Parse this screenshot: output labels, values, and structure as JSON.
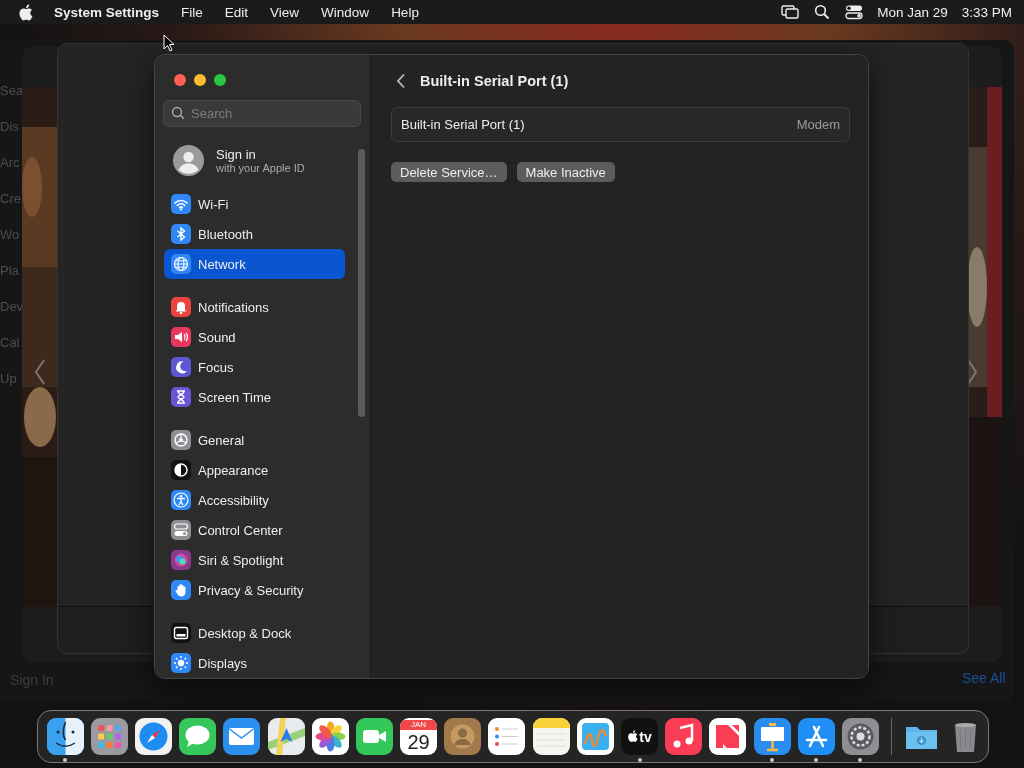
{
  "menu_bar": {
    "items": [
      {
        "label": "System Settings",
        "kind": "app"
      },
      {
        "label": "File",
        "kind": "menu"
      },
      {
        "label": "Edit",
        "kind": "menu"
      },
      {
        "label": "View",
        "kind": "menu"
      },
      {
        "label": "Window",
        "kind": "menu"
      },
      {
        "label": "Help",
        "kind": "menu"
      }
    ],
    "date": "Mon Jan 29",
    "time": "3:33 PM"
  },
  "background_window": {
    "sidebar_fragments": [
      "Sea",
      "Dis",
      "Arc",
      "Cre",
      "Wo",
      "Pla",
      "Dev",
      "Cal",
      "Up"
    ],
    "sign_in": "Sign In",
    "see_all": "See All"
  },
  "window": {
    "search": {
      "placeholder": "Search"
    },
    "account": {
      "name": "Sign in",
      "subtitle": "with your Apple ID"
    },
    "sidebar": {
      "groups": [
        {
          "items": [
            {
              "label": "Wi-Fi",
              "color": "#2f88f5",
              "selected": false
            },
            {
              "label": "Bluetooth",
              "color": "#2f88f5",
              "selected": false
            },
            {
              "label": "Network",
              "color": "#2f88f5",
              "selected": true
            }
          ]
        },
        {
          "items": [
            {
              "label": "Notifications",
              "color": "#e9443f",
              "selected": false
            },
            {
              "label": "Sound",
              "color": "#e8385d",
              "selected": false
            },
            {
              "label": "Focus",
              "color": "#5d57d6",
              "selected": false
            },
            {
              "label": "Screen Time",
              "color": "#6a55d8",
              "selected": false
            }
          ]
        },
        {
          "items": [
            {
              "label": "General",
              "color": "#8e8e93",
              "selected": false
            },
            {
              "label": "Appearance",
              "color": "#111111",
              "selected": false
            },
            {
              "label": "Accessibility",
              "color": "#2f88f5",
              "selected": false
            },
            {
              "label": "Control Center",
              "color": "#8e8e93",
              "selected": false
            },
            {
              "label": "Siri & Spotlight",
              "color": "#8a3a8c",
              "selected": false
            },
            {
              "label": "Privacy & Security",
              "color": "#2f88f5",
              "selected": false
            }
          ]
        },
        {
          "items": [
            {
              "label": "Desktop & Dock",
              "color": "#111111",
              "selected": false
            },
            {
              "label": "Displays",
              "color": "#2f88f5",
              "selected": false
            }
          ]
        }
      ]
    },
    "content": {
      "title": "Built-in Serial Port (1)",
      "service": {
        "name": "Built-in Serial Port (1)",
        "type": "Modem"
      },
      "buttons": [
        "Delete Service…",
        "Make Inactive"
      ]
    }
  },
  "dock": {
    "apps": [
      {
        "color": "#3aa0f0",
        "running": true
      },
      {
        "color": "#9a9aa0",
        "running": false
      },
      {
        "color": "#f2f2f2",
        "running": false
      },
      {
        "color": "#35c759",
        "running": false
      },
      {
        "color": "#2b8ff0",
        "running": false
      },
      {
        "color": "#e9ecef",
        "running": false
      },
      {
        "color": "#ffffff",
        "running": false
      },
      {
        "color": "#34c759",
        "running": false
      },
      {
        "color": "#ffffff",
        "running": false,
        "month": "JAN",
        "day": "29"
      },
      {
        "color": "#a07a4a",
        "running": false
      },
      {
        "color": "#ffffff",
        "running": false
      },
      {
        "color": "#f6f6f0",
        "running": false
      },
      {
        "color": "#ffffff",
        "running": false
      },
      {
        "color": "#111111",
        "running": true,
        "label": "tv"
      },
      {
        "color": "#fa3c55",
        "running": false
      },
      {
        "color": "#ffffff",
        "running": false
      },
      {
        "color": "#2a8cf0",
        "running": true
      },
      {
        "color": "#1f8ef5",
        "running": true
      },
      {
        "color": "#8e8e93",
        "running": true
      }
    ],
    "stacks": [
      {
        "color": "#5fb4e8"
      },
      {
        "color": "#8a8a8e"
      }
    ]
  }
}
